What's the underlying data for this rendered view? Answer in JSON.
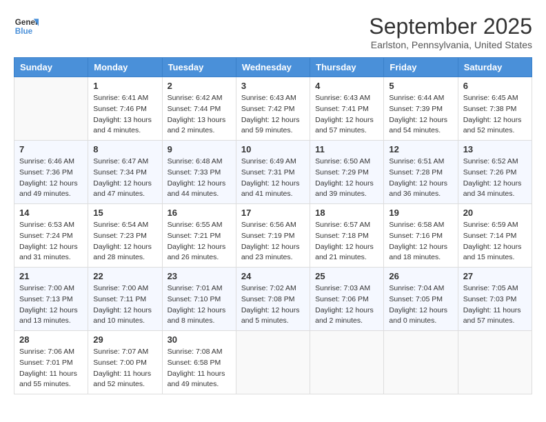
{
  "header": {
    "logo_line1": "General",
    "logo_line2": "Blue",
    "month_title": "September 2025",
    "subtitle": "Earlston, Pennsylvania, United States"
  },
  "weekdays": [
    "Sunday",
    "Monday",
    "Tuesday",
    "Wednesday",
    "Thursday",
    "Friday",
    "Saturday"
  ],
  "weeks": [
    [
      {
        "day": "",
        "empty": true
      },
      {
        "day": "1",
        "sunrise": "6:41 AM",
        "sunset": "7:46 PM",
        "daylight": "13 hours and 4 minutes."
      },
      {
        "day": "2",
        "sunrise": "6:42 AM",
        "sunset": "7:44 PM",
        "daylight": "13 hours and 2 minutes."
      },
      {
        "day": "3",
        "sunrise": "6:43 AM",
        "sunset": "7:42 PM",
        "daylight": "12 hours and 59 minutes."
      },
      {
        "day": "4",
        "sunrise": "6:43 AM",
        "sunset": "7:41 PM",
        "daylight": "12 hours and 57 minutes."
      },
      {
        "day": "5",
        "sunrise": "6:44 AM",
        "sunset": "7:39 PM",
        "daylight": "12 hours and 54 minutes."
      },
      {
        "day": "6",
        "sunrise": "6:45 AM",
        "sunset": "7:38 PM",
        "daylight": "12 hours and 52 minutes."
      }
    ],
    [
      {
        "day": "7",
        "sunrise": "6:46 AM",
        "sunset": "7:36 PM",
        "daylight": "12 hours and 49 minutes."
      },
      {
        "day": "8",
        "sunrise": "6:47 AM",
        "sunset": "7:34 PM",
        "daylight": "12 hours and 47 minutes."
      },
      {
        "day": "9",
        "sunrise": "6:48 AM",
        "sunset": "7:33 PM",
        "daylight": "12 hours and 44 minutes."
      },
      {
        "day": "10",
        "sunrise": "6:49 AM",
        "sunset": "7:31 PM",
        "daylight": "12 hours and 41 minutes."
      },
      {
        "day": "11",
        "sunrise": "6:50 AM",
        "sunset": "7:29 PM",
        "daylight": "12 hours and 39 minutes."
      },
      {
        "day": "12",
        "sunrise": "6:51 AM",
        "sunset": "7:28 PM",
        "daylight": "12 hours and 36 minutes."
      },
      {
        "day": "13",
        "sunrise": "6:52 AM",
        "sunset": "7:26 PM",
        "daylight": "12 hours and 34 minutes."
      }
    ],
    [
      {
        "day": "14",
        "sunrise": "6:53 AM",
        "sunset": "7:24 PM",
        "daylight": "12 hours and 31 minutes."
      },
      {
        "day": "15",
        "sunrise": "6:54 AM",
        "sunset": "7:23 PM",
        "daylight": "12 hours and 28 minutes."
      },
      {
        "day": "16",
        "sunrise": "6:55 AM",
        "sunset": "7:21 PM",
        "daylight": "12 hours and 26 minutes."
      },
      {
        "day": "17",
        "sunrise": "6:56 AM",
        "sunset": "7:19 PM",
        "daylight": "12 hours and 23 minutes."
      },
      {
        "day": "18",
        "sunrise": "6:57 AM",
        "sunset": "7:18 PM",
        "daylight": "12 hours and 21 minutes."
      },
      {
        "day": "19",
        "sunrise": "6:58 AM",
        "sunset": "7:16 PM",
        "daylight": "12 hours and 18 minutes."
      },
      {
        "day": "20",
        "sunrise": "6:59 AM",
        "sunset": "7:14 PM",
        "daylight": "12 hours and 15 minutes."
      }
    ],
    [
      {
        "day": "21",
        "sunrise": "7:00 AM",
        "sunset": "7:13 PM",
        "daylight": "12 hours and 13 minutes."
      },
      {
        "day": "22",
        "sunrise": "7:00 AM",
        "sunset": "7:11 PM",
        "daylight": "12 hours and 10 minutes."
      },
      {
        "day": "23",
        "sunrise": "7:01 AM",
        "sunset": "7:10 PM",
        "daylight": "12 hours and 8 minutes."
      },
      {
        "day": "24",
        "sunrise": "7:02 AM",
        "sunset": "7:08 PM",
        "daylight": "12 hours and 5 minutes."
      },
      {
        "day": "25",
        "sunrise": "7:03 AM",
        "sunset": "7:06 PM",
        "daylight": "12 hours and 2 minutes."
      },
      {
        "day": "26",
        "sunrise": "7:04 AM",
        "sunset": "7:05 PM",
        "daylight": "12 hours and 0 minutes."
      },
      {
        "day": "27",
        "sunrise": "7:05 AM",
        "sunset": "7:03 PM",
        "daylight": "11 hours and 57 minutes."
      }
    ],
    [
      {
        "day": "28",
        "sunrise": "7:06 AM",
        "sunset": "7:01 PM",
        "daylight": "11 hours and 55 minutes."
      },
      {
        "day": "29",
        "sunrise": "7:07 AM",
        "sunset": "7:00 PM",
        "daylight": "11 hours and 52 minutes."
      },
      {
        "day": "30",
        "sunrise": "7:08 AM",
        "sunset": "6:58 PM",
        "daylight": "11 hours and 49 minutes."
      },
      {
        "day": "",
        "empty": true
      },
      {
        "day": "",
        "empty": true
      },
      {
        "day": "",
        "empty": true
      },
      {
        "day": "",
        "empty": true
      }
    ]
  ],
  "labels": {
    "sunrise": "Sunrise:",
    "sunset": "Sunset:",
    "daylight": "Daylight:"
  }
}
